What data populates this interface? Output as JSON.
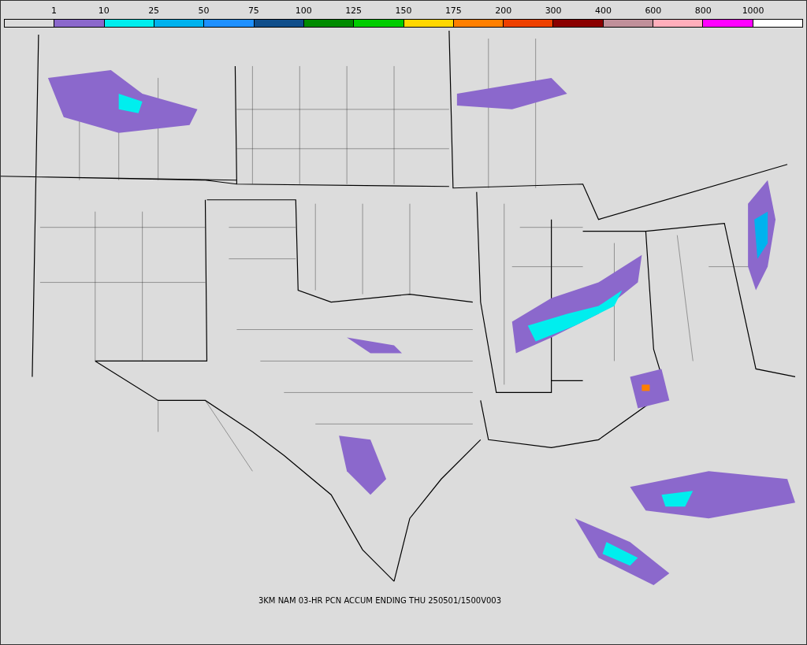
{
  "legend": {
    "bins": [
      {
        "color": "#dcdcdc",
        "label": "1"
      },
      {
        "color": "#8b68cc",
        "label": "10"
      },
      {
        "color": "#00eeee",
        "label": "25"
      },
      {
        "color": "#00b2ee",
        "label": "50"
      },
      {
        "color": "#1e90ff",
        "label": "75"
      },
      {
        "color": "#104e8b",
        "label": "100"
      },
      {
        "color": "#008b00",
        "label": "125"
      },
      {
        "color": "#00cd00",
        "label": "150"
      },
      {
        "color": "#ffd700",
        "label": "175"
      },
      {
        "color": "#ff7f00",
        "label": "200"
      },
      {
        "color": "#ee4000",
        "label": "300"
      },
      {
        "color": "#8b0000",
        "label": "400"
      },
      {
        "color": "#c0909a",
        "label": "600"
      },
      {
        "color": "#ffaebb",
        "label": "800"
      },
      {
        "color": "#ff00ff",
        "label": "1000"
      },
      {
        "color": "#ffffff"
      }
    ]
  },
  "map": {
    "caption": "3KM NAM 03-HR PCN ACCUM ENDING THU 250501/1500V003"
  }
}
